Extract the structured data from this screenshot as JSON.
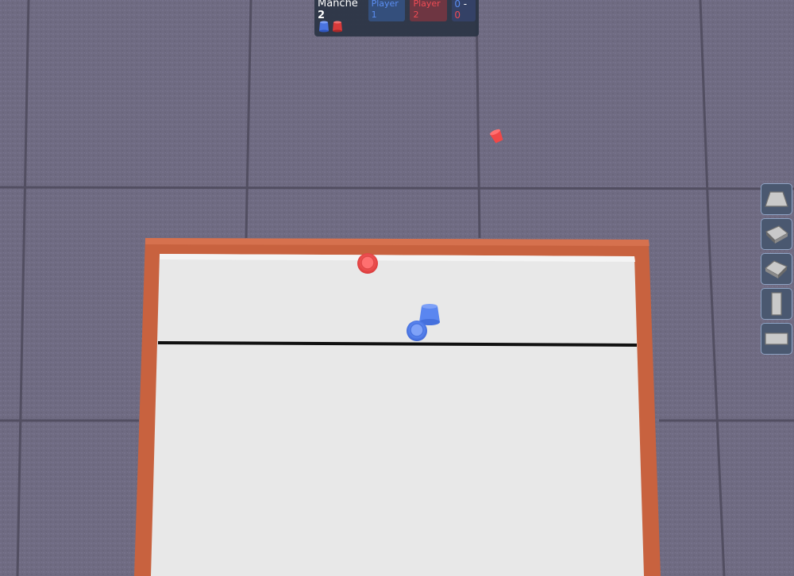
{
  "hud": {
    "round_word": "Manche",
    "round_number": "2",
    "player1": "Player 1",
    "player2": "Player 2",
    "score_p1": "0",
    "score_separator": "-",
    "score_p2": "0"
  },
  "colors": {
    "player1": "#5b8ef2",
    "player2": "#ef4c55",
    "floor": "#6f6b82",
    "table_frame": "#c8623f",
    "table_surface": "#e8e8e8"
  },
  "toolbar": {
    "items": [
      {
        "icon": "table-front-view-icon"
      },
      {
        "icon": "table-iso-left-icon"
      },
      {
        "icon": "table-iso-right-icon"
      },
      {
        "icon": "table-top-vertical-icon"
      },
      {
        "icon": "table-top-horizontal-icon"
      }
    ]
  }
}
